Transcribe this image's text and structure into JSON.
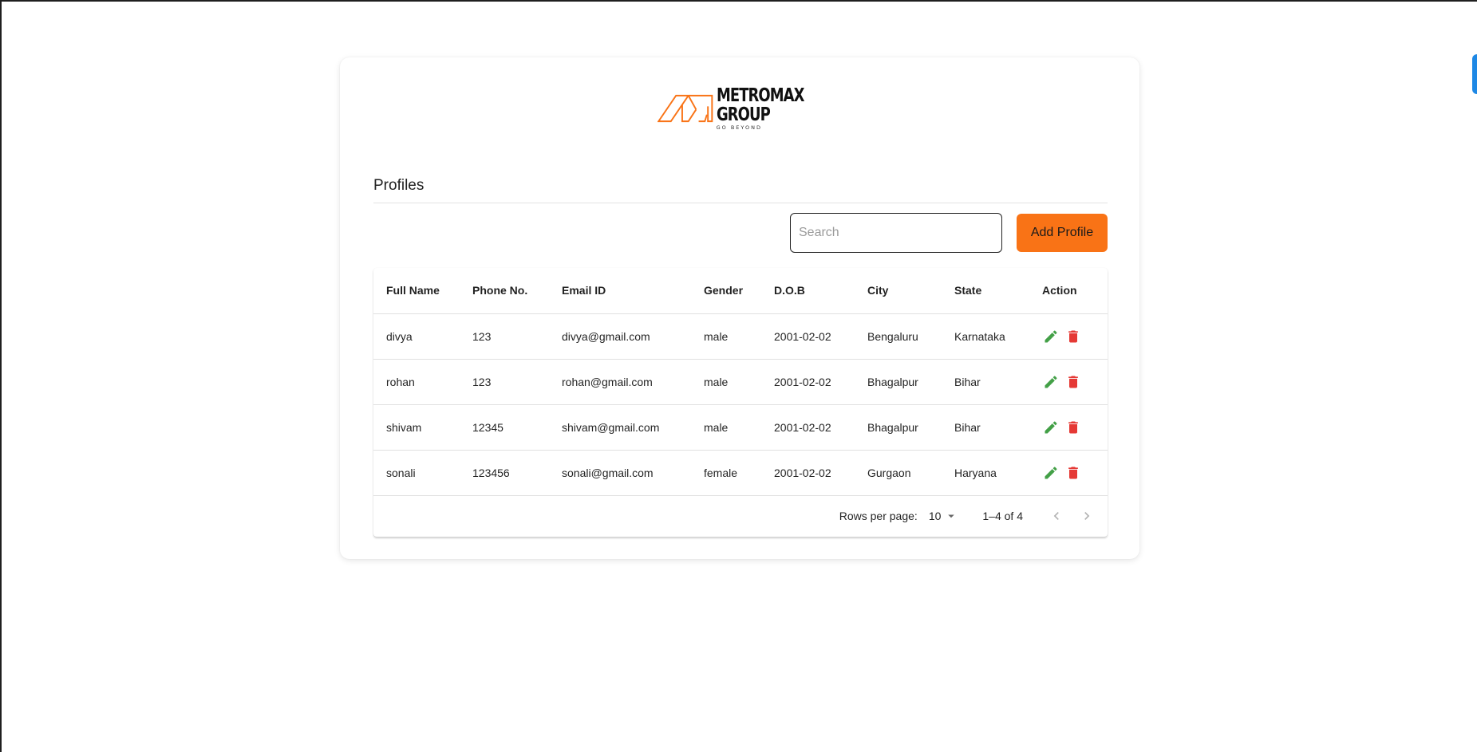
{
  "brand": {
    "name_line1": "METROMAX",
    "name_line2": "GROUP",
    "tagline": "GO BEYOND",
    "color": "#f97316"
  },
  "section": {
    "title": "Profiles"
  },
  "toolbar": {
    "search_placeholder": "Search",
    "search_value": "",
    "add_label": "Add Profile"
  },
  "table": {
    "columns": [
      "Full Name",
      "Phone No.",
      "Email ID",
      "Gender",
      "D.O.B",
      "City",
      "State",
      "Action"
    ],
    "rows": [
      {
        "name": "divya",
        "phone": "123",
        "email": "divya@gmail.com",
        "gender": "male",
        "dob": "2001-02-02",
        "city": "Bengaluru",
        "state": "Karnataka"
      },
      {
        "name": "rohan",
        "phone": "123",
        "email": "rohan@gmail.com",
        "gender": "male",
        "dob": "2001-02-02",
        "city": "Bhagalpur",
        "state": "Bihar"
      },
      {
        "name": "shivam",
        "phone": "12345",
        "email": "shivam@gmail.com",
        "gender": "male",
        "dob": "2001-02-02",
        "city": "Bhagalpur",
        "state": "Bihar"
      },
      {
        "name": "sonali",
        "phone": "123456",
        "email": "sonali@gmail.com",
        "gender": "female",
        "dob": "2001-02-02",
        "city": "Gurgaon",
        "state": "Haryana"
      }
    ],
    "action_icons": [
      "pencil-icon",
      "trash-icon"
    ],
    "edit_color": "#43a047",
    "delete_color": "#e53935"
  },
  "pagination": {
    "rows_per_page_label": "Rows per page:",
    "rows_per_page_value": "10",
    "range_text": "1–4 of 4"
  },
  "colors": {
    "accent": "#f97316",
    "side_tab": "#1e88e5"
  }
}
